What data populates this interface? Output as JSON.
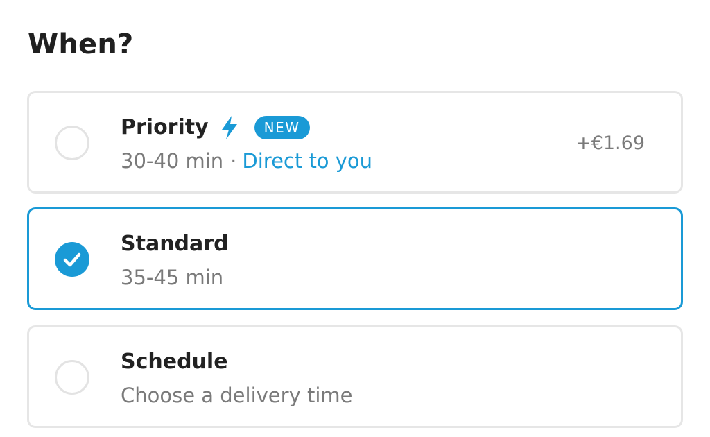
{
  "heading": "When?",
  "accent_color": "#1a9ad6",
  "options": {
    "priority": {
      "title": "Priority",
      "icon": "lightning-bolt-icon",
      "badge": "NEW",
      "time": "30-40 min",
      "separator": "·",
      "detail": "Direct to you",
      "price": "+€1.69",
      "selected": false
    },
    "standard": {
      "title": "Standard",
      "time": "35-45 min",
      "selected": true
    },
    "schedule": {
      "title": "Schedule",
      "subtitle": "Choose a delivery time",
      "selected": false
    }
  }
}
